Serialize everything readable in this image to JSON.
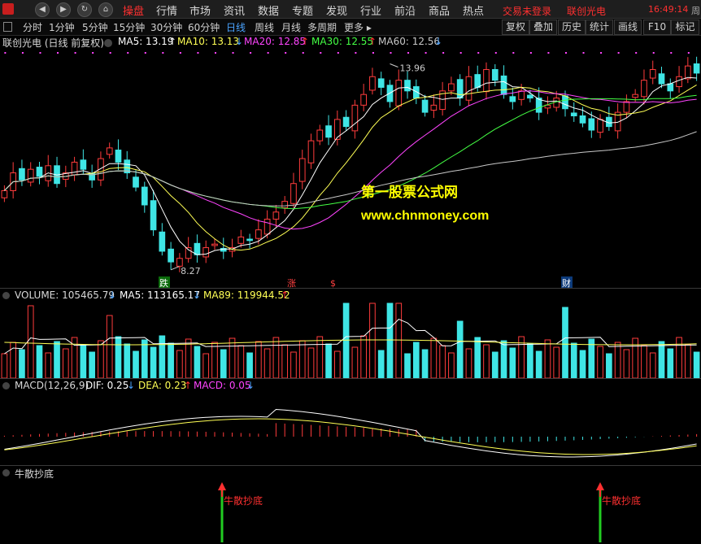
{
  "topbar": {
    "menu": [
      "操盘",
      "行情",
      "市场",
      "资讯",
      "数据",
      "专题",
      "发现",
      "行业",
      "前沿",
      "商品",
      "热点"
    ],
    "login_status": "交易未登录",
    "stock_name": "联创光电",
    "time": "16:49:14",
    "extra": "周"
  },
  "toolbar": {
    "periods": [
      "分时",
      "1分钟",
      "5分钟",
      "15分钟",
      "30分钟",
      "60分钟",
      "日线",
      "周线",
      "月线",
      "多周期",
      "更多"
    ],
    "active_period": "日线",
    "right_buttons": [
      "复权",
      "叠加",
      "历史",
      "统计",
      "画线",
      "F10",
      "标记"
    ]
  },
  "legend": {
    "title": "联创光电 (日线 前复权)",
    "ma5": "MA5: 13.19",
    "ma10": "MA10: 13.13",
    "ma20": "MA20: 12.85",
    "ma30": "MA30: 12.55",
    "ma60": "MA60: 12.56",
    "high_label": "13.96",
    "low_label": "8.27",
    "markers": {
      "die": "跌",
      "zhang": "涨",
      "s": "$",
      "cai": "财"
    }
  },
  "watermark": {
    "line1": "第一股票公式网",
    "line2": "www.chnmoney.com"
  },
  "volume": {
    "label": "VOLUME: 105465.79",
    "ma5": "MA5: 113165.17",
    "ma89": "MA89: 119944.52"
  },
  "macd": {
    "label": "MACD(12,26,9)",
    "dif": "DIF: 0.25",
    "dea": "DEA: 0.23",
    "macd": "MACD: 0.05"
  },
  "indicator": {
    "title": "牛散抄底",
    "signal_label": "牛散抄底"
  },
  "colors": {
    "up": "#ff3c3c",
    "down": "#3fe5e5",
    "ma5": "#ffffff",
    "ma10": "#ffff55",
    "ma20": "#ff44ff",
    "ma30": "#44ff44",
    "ma60": "#c8c8c8",
    "signal": "#22cc22"
  },
  "chart_data": {
    "type": "candlestick",
    "series_hint": "daily price, approximate",
    "closes": [
      10.4,
      10.9,
      10.7,
      11.0,
      10.8,
      11.1,
      10.6,
      10.9,
      11.2,
      11.0,
      10.7,
      11.3,
      11.6,
      11.2,
      10.9,
      10.5,
      10.0,
      9.3,
      8.7,
      8.4,
      8.5,
      8.8,
      8.6,
      8.8,
      8.9,
      8.7,
      8.8,
      9.1,
      9.0,
      9.3,
      9.6,
      9.8,
      10.1,
      10.6,
      11.3,
      11.8,
      12.1,
      11.9,
      12.4,
      12.2,
      12.8,
      13.1,
      13.6,
      13.3,
      12.9,
      13.5,
      13.2,
      13.0,
      12.6,
      12.8,
      13.2,
      13.4,
      13.0,
      13.6,
      13.3,
      13.8,
      13.5,
      13.1,
      12.9,
      13.2,
      13.0,
      12.6,
      12.8,
      13.0,
      12.7,
      12.5,
      12.3,
      12.1,
      12.4,
      12.2,
      12.6,
      12.9,
      13.1,
      13.5,
      13.8,
      13.4,
      13.2,
      13.6,
      13.9,
      13.7
    ],
    "high": 13.96,
    "low": 8.27,
    "signals_at_index": [
      19,
      62
    ]
  }
}
